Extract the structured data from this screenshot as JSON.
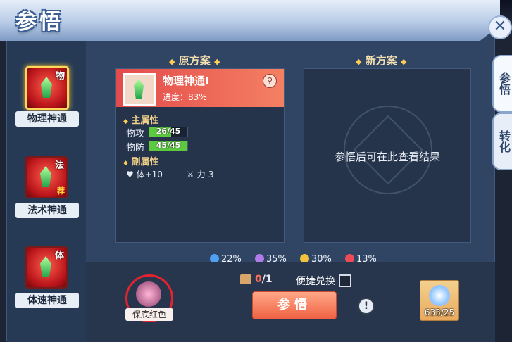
{
  "window": {
    "title": "参悟",
    "close_symbol": "✕"
  },
  "sidebar": {
    "items": [
      {
        "label": "物理神通",
        "tag": "物",
        "active": true,
        "recommend": ""
      },
      {
        "label": "法术神通",
        "tag": "法",
        "active": false,
        "recommend": "荐"
      },
      {
        "label": "体速神通",
        "tag": "体",
        "active": false,
        "recommend": ""
      }
    ]
  },
  "side_tabs": [
    {
      "label": "参悟"
    },
    {
      "label": "转化"
    }
  ],
  "original": {
    "title": "原方案",
    "skill_name": "物理神通Ⅰ",
    "progress_label": "进度：83%",
    "main_attr_title": "主属性",
    "main_attrs": [
      {
        "name": "物攻",
        "value": "26/45",
        "fraction": 0.578
      },
      {
        "name": "物防",
        "value": "45/45",
        "fraction": 1.0
      }
    ],
    "sub_attr_title": "副属性",
    "sub_attrs": [
      {
        "icon": "heart-icon",
        "text": "体+10"
      },
      {
        "icon": "sword-icon",
        "text": "力-3"
      }
    ]
  },
  "new_plan": {
    "title": "新方案",
    "empty_text": "参悟后可在此查看结果"
  },
  "probabilities": [
    {
      "color": "#4ea1f0",
      "value": "22%"
    },
    {
      "color": "#b07ae8",
      "value": "35%"
    },
    {
      "color": "#f3c23a",
      "value": "30%"
    },
    {
      "color": "#ef4a55",
      "value": "13%"
    }
  ],
  "bottom": {
    "guarantee_label": "保底红色",
    "material_owned": "0",
    "material_needed": "/1",
    "quick_exchange": "便捷兑换",
    "action_button": "参悟",
    "item_count": "633/25",
    "info_symbol": "!"
  },
  "colors": {
    "accent_red": "#e34b4b",
    "gold": "#f3dfb0",
    "panel": "#2f4563"
  }
}
